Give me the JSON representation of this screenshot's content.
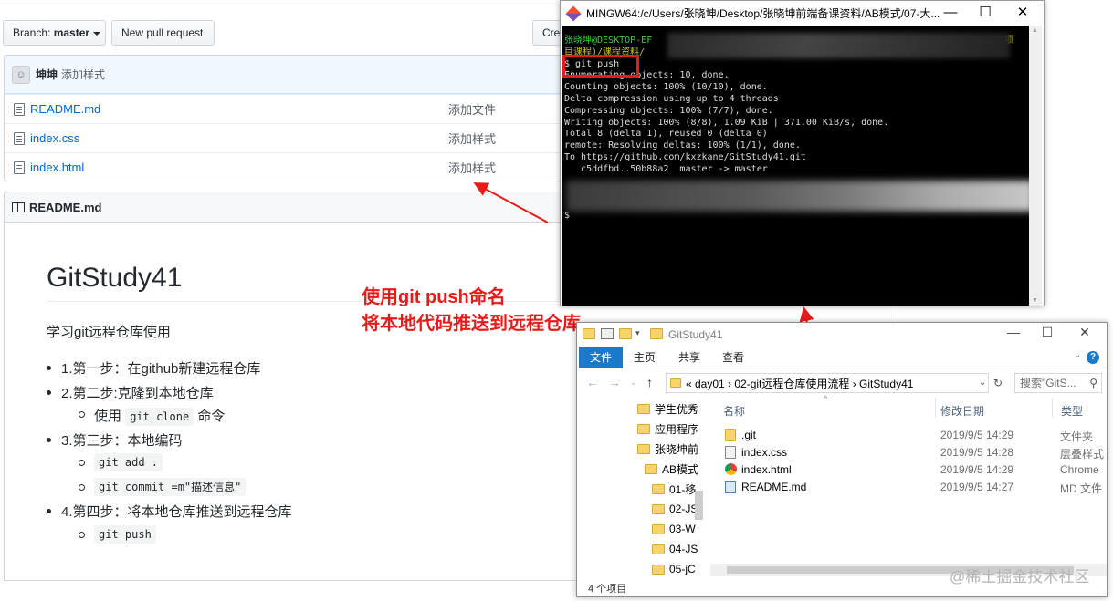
{
  "github": {
    "branch_label": "Branch:",
    "branch_value": "master",
    "new_pr_label": "New pull request",
    "create_label": "Crea",
    "commit": {
      "avatar_text": "☺",
      "author": "坤坤",
      "message": "添加样式"
    },
    "files": [
      {
        "name": "README.md",
        "commit": "添加文件"
      },
      {
        "name": "index.css",
        "commit": "添加样式"
      },
      {
        "name": "index.html",
        "commit": "添加样式"
      }
    ],
    "readme": {
      "header": "README.md",
      "title": "GitStudy41",
      "desc": "学习git远程仓库使用",
      "step1": "1.第一步：在github新建远程仓库",
      "step2": "2.第二步:克隆到本地仓库",
      "step2_sub_prefix": "使用",
      "step2_sub_code": "git clone",
      "step2_sub_suffix": "命令",
      "step3": "3.第三步：本地编码",
      "step3_sub1_code": "git add .",
      "step3_sub2_code": "git commit =m\"描述信息\"",
      "step4": "4.第四步：将本地仓库推送到远程仓库",
      "step4_sub_code": "git push"
    }
  },
  "terminal": {
    "title": "MINGW64:/c/Users/张晓坤/Desktop/张晓坤前端备课资料/AB模式/07-大...",
    "prompt_user": "张晓坤@DESKTOP-EF",
    "prompt_suffix": "C项",
    "prompt_path": "目课程)/课程资料/",
    "lines": [
      "$ git push",
      "Enumerating objects: 10, done.",
      "Counting objects: 100% (10/10), done.",
      "Delta compression using up to 4 threads",
      "Compressing objects: 100% (7/7), done.",
      "Writing objects: 100% (8/8), 1.09 KiB | 371.00 KiB/s, done.",
      "Total 8 (delta 1), reused 0 (delta 0)",
      "remote: Resolving deltas: 100% (1/1), done.",
      "To https://github.com/kxzkane/GitStudy41.git",
      "   c5ddfbd..50b88a2  master -> master"
    ],
    "final_prompt": "$",
    "minimize": "—",
    "maximize": "☐",
    "close": "✕"
  },
  "annotation": {
    "line1": "使用git push命名",
    "line2": "将本地代码推送到远程仓库"
  },
  "explorer": {
    "title": "GitStudy41",
    "minimize": "—",
    "maximize": "☐",
    "close": "✕",
    "tabs": {
      "file": "文件",
      "home": "主页",
      "share": "共享",
      "view": "查看"
    },
    "help": "?",
    "breadcrumb": "«  day01  ›  02-git远程仓库使用流程  ›  GitStudy41",
    "search_placeholder": "搜索\"GitS...",
    "nav_items": [
      "学生优秀",
      "应用程序",
      "张晓坤前",
      "AB模式",
      "01-移",
      "02-JS",
      "03-W",
      "04-JS",
      "05-jC"
    ],
    "columns": {
      "name": "名称",
      "date": "修改日期",
      "type": "类型"
    },
    "files": [
      {
        "name": ".git",
        "date": "2019/9/5 14:29",
        "type": "文件夹",
        "icon": "folder"
      },
      {
        "name": "index.css",
        "date": "2019/9/5 14:28",
        "type": "层叠样式",
        "icon": "css"
      },
      {
        "name": "index.html",
        "date": "2019/9/5 14:29",
        "type": "Chrome",
        "icon": "chrome"
      },
      {
        "name": "README.md",
        "date": "2019/9/5 14:27",
        "type": "MD 文件",
        "icon": "md"
      }
    ],
    "status": "4 个项目"
  },
  "watermark": "@稀土掘金技术社区",
  "colors": {
    "accent_red": "#e81b1b",
    "link_blue": "#0366d6",
    "ribbon_blue": "#1979ca"
  }
}
